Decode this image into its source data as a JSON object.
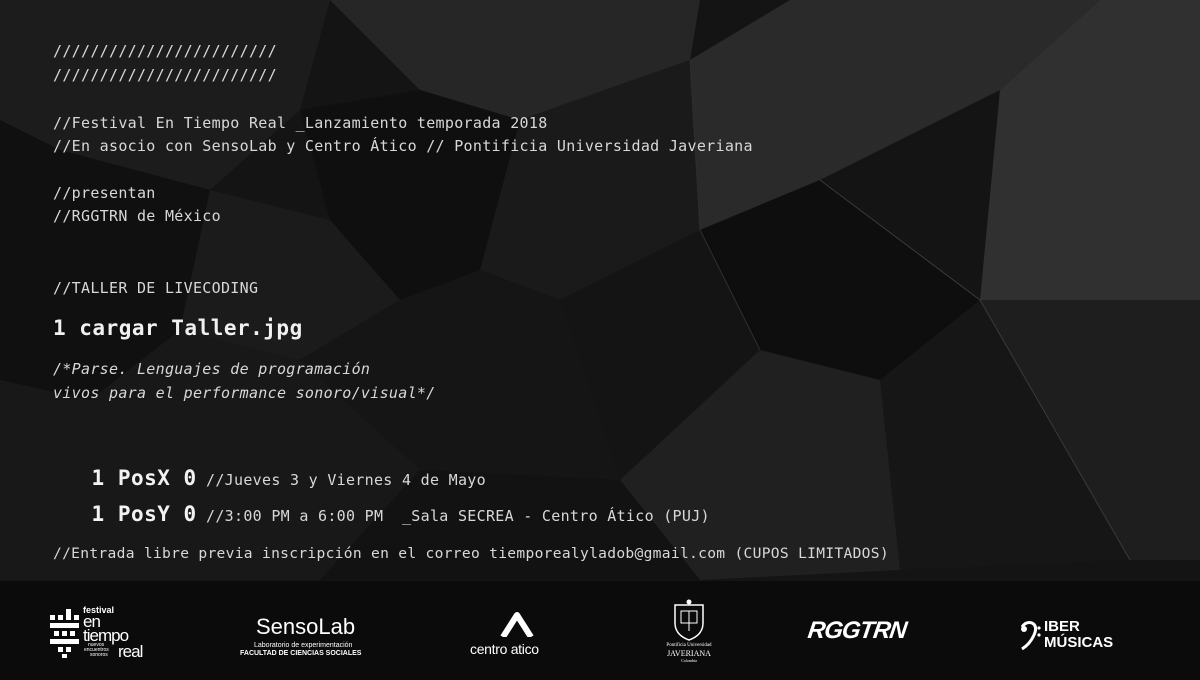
{
  "header": {
    "slashes_1": "////////////////////////",
    "slashes_2": "////////////////////////"
  },
  "intro": {
    "line_1": "//Festival En Tiempo Real _Lanzamiento temporada 2018",
    "line_2": "//En asocio con SensoLab y Centro Ático // Pontificia Universidad Javeriana",
    "line_3": "//presentan",
    "line_4": "//RGGTRN de México"
  },
  "workshop": {
    "label": "//TALLER DE LIVECODING",
    "command": "1 cargar Taller.jpg",
    "comment_1": "/*Parse. Lenguajes de programación",
    "comment_2": "vivos para el performance sonoro/visual*/"
  },
  "schedule": {
    "posx_label": "1 PosX 0",
    "posx_detail": " //Jueves 3 y Viernes 4 de Mayo",
    "posy_label": "1 PosY 0",
    "posy_detail": " //3:00 PM a 6:00 PM  _Sala SECREA - Centro Ático (PUJ)"
  },
  "registration": {
    "text": "//Entrada libre previa inscripción en el correo tiemporealyladob@gmail.com (CUPOS LIMITADOS)"
  },
  "logos": {
    "festival": {
      "line_1": "festival",
      "line_2": "en",
      "line_3": "tiempo",
      "line_4": "real",
      "sub_1": "nuevos",
      "sub_2": "encuentros",
      "sub_3": "sonoros"
    },
    "sensolab": {
      "name": "SensoLab",
      "sub_1": "Laboratorio de experimentación",
      "sub_2": "FACULTAD DE CIENCIAS SOCIALES"
    },
    "centro_atico": {
      "name": "centro atico"
    },
    "javeriana": {
      "line_1": "Pontificia Universidad",
      "line_2": "JAVERIANA",
      "line_3": "Colombia"
    },
    "rggtrn": {
      "name": "RGGTRN"
    },
    "ibermusicas": {
      "line_1": "IBER",
      "line_2": "MÚSICAS"
    }
  },
  "colors": {
    "background": "#131313",
    "text": "#d8d8d8",
    "footer": "#0b0b0b"
  }
}
